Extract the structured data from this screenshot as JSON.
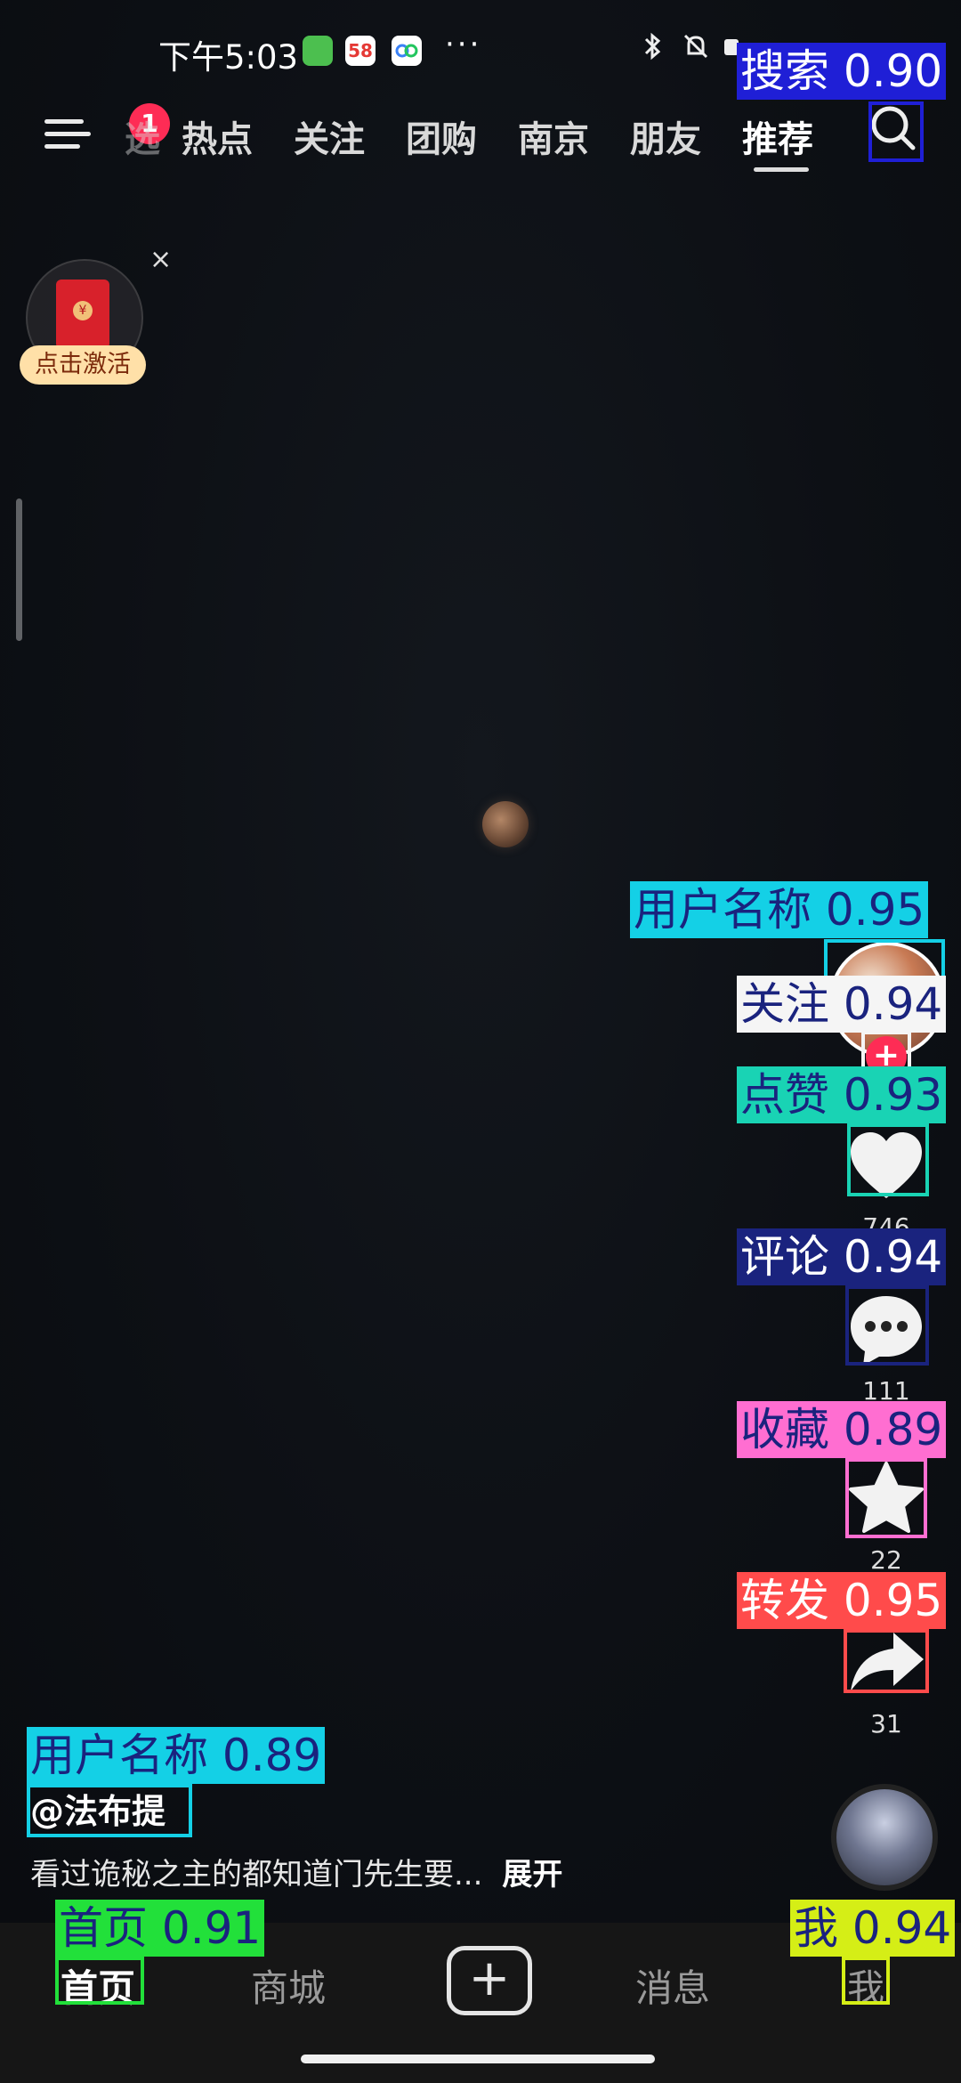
{
  "status_bar": {
    "time": "下午5:03",
    "more": "···",
    "app_badge_58": "58"
  },
  "top_nav": {
    "notification_badge": "1",
    "tabs": [
      "热点",
      "关注",
      "团购",
      "南京",
      "朋友",
      "推荐"
    ],
    "faded_tab_fragment": "选",
    "active_tab": "推荐"
  },
  "red_packet": {
    "label": "点击激活",
    "coin": "¥",
    "close": "×"
  },
  "video": {
    "author": "@法布提",
    "caption": "看过诡秘之主的都知道门先生要...",
    "expand": "展开",
    "likes": "746",
    "comments": "111",
    "favorites": "22",
    "shares": "31"
  },
  "bottom_tabs": {
    "home": "首页",
    "mall": "商城",
    "create": "+",
    "messages": "消息",
    "me": "我"
  },
  "detections": [
    {
      "label": "搜索 0.90",
      "color": "#1f1fd6",
      "text_color": "#ffffff"
    },
    {
      "label": "用户名称 0.95",
      "color": "#14d0e6",
      "text_color": "#1a237e"
    },
    {
      "label": "关注 0.94",
      "color": "#f5f5f5",
      "text_color": "#1a237e"
    },
    {
      "label": "点赞 0.93",
      "color": "#19d3b4",
      "text_color": "#1a237e"
    },
    {
      "label": "评论 0.94",
      "color": "#1a237e",
      "text_color": "#ffffff"
    },
    {
      "label": "收藏 0.89",
      "color": "#ff6ed1",
      "text_color": "#1a237e"
    },
    {
      "label": "转发 0.95",
      "color": "#ff4b4b",
      "text_color": "#ffffff"
    },
    {
      "label": "用户名称 0.89",
      "color": "#14d0e6",
      "text_color": "#1a237e"
    },
    {
      "label": "首页 0.91",
      "color": "#22e03a",
      "text_color": "#1a237e"
    },
    {
      "label": "我 0.94",
      "color": "#d5ee16",
      "text_color": "#1a237e"
    }
  ],
  "colors": {
    "accent_red": "#fe2c55",
    "background": "#0b0d11",
    "tabbar": "#161616"
  }
}
